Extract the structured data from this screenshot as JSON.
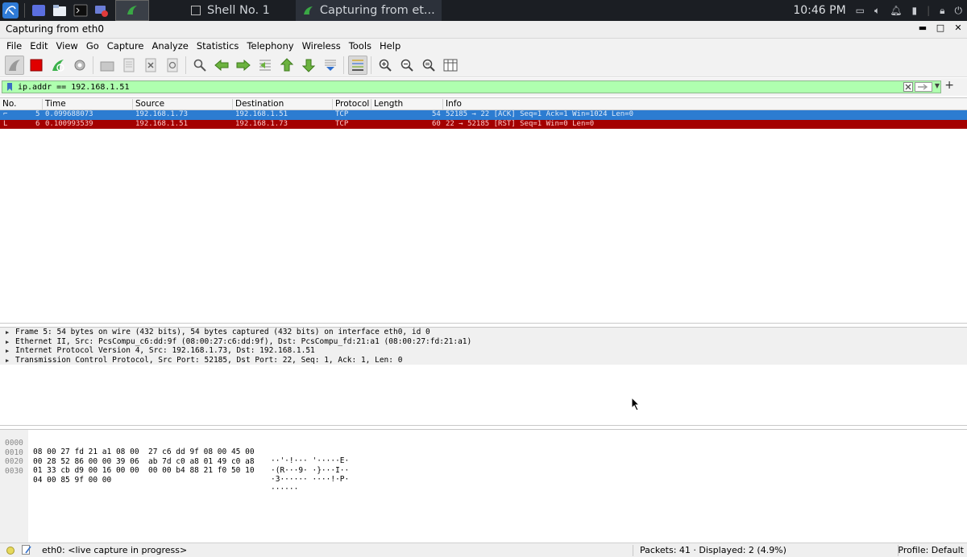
{
  "taskbar": {
    "apps": [
      {
        "label": "Shell No. 1",
        "icon": "terminal-icon"
      },
      {
        "label": "Capturing from et...",
        "icon": "wireshark-fin-icon"
      }
    ],
    "clock": "10:46 PM"
  },
  "window": {
    "title": "Capturing from eth0"
  },
  "menu": [
    "File",
    "Edit",
    "View",
    "Go",
    "Capture",
    "Analyze",
    "Statistics",
    "Telephony",
    "Wireless",
    "Tools",
    "Help"
  ],
  "filter": {
    "value": "ip.addr == 192.168.1.51",
    "bg_color": "#afffaf"
  },
  "packet_list": {
    "columns": [
      "No.",
      "Time",
      "Source",
      "Destination",
      "Protocol",
      "Length",
      "Info"
    ],
    "rows": [
      {
        "no": "5",
        "time": "0.099688073",
        "source": "192.168.1.73",
        "destination": "192.168.1.51",
        "protocol": "TCP",
        "length": "54",
        "info": "52185 → 22 [ACK] Seq=1 Ack=1 Win=1024 Len=0",
        "style": "selected"
      },
      {
        "no": "6",
        "time": "0.100993539",
        "source": "192.168.1.51",
        "destination": "192.168.1.73",
        "protocol": "TCP",
        "length": "60",
        "info": "22 → 52185 [RST] Seq=1 Win=0 Len=0",
        "style": "rst"
      }
    ]
  },
  "details": [
    "Frame 5: 54 bytes on wire (432 bits), 54 bytes captured (432 bits) on interface eth0, id 0",
    "Ethernet II, Src: PcsCompu_c6:dd:9f (08:00:27:c6:dd:9f), Dst: PcsCompu_fd:21:a1 (08:00:27:fd:21:a1)",
    "Internet Protocol Version 4, Src: 192.168.1.73, Dst: 192.168.1.51",
    "Transmission Control Protocol, Src Port: 52185, Dst Port: 22, Seq: 1, Ack: 1, Len: 0"
  ],
  "bytes": [
    {
      "offset": "0000",
      "hex": "08 00 27 fd 21 a1 08 00  27 c6 dd 9f 08 00 45 00",
      "ascii": "··'·!··· '·····E·"
    },
    {
      "offset": "0010",
      "hex": "00 28 52 86 00 00 39 06  ab 7d c0 a8 01 49 c0 a8",
      "ascii": "·(R···9· ·}···I··"
    },
    {
      "offset": "0020",
      "hex": "01 33 cb d9 00 16 00 00  00 00 b4 88 21 f0 50 10",
      "ascii": "·3······ ····!·P·"
    },
    {
      "offset": "0030",
      "hex": "04 00 85 9f 00 00",
      "ascii": "······"
    }
  ],
  "status": {
    "interface": "eth0: <live capture in progress>",
    "packets": "Packets: 41 · Displayed: 2 (4.9%)",
    "profile": "Profile: Default"
  }
}
